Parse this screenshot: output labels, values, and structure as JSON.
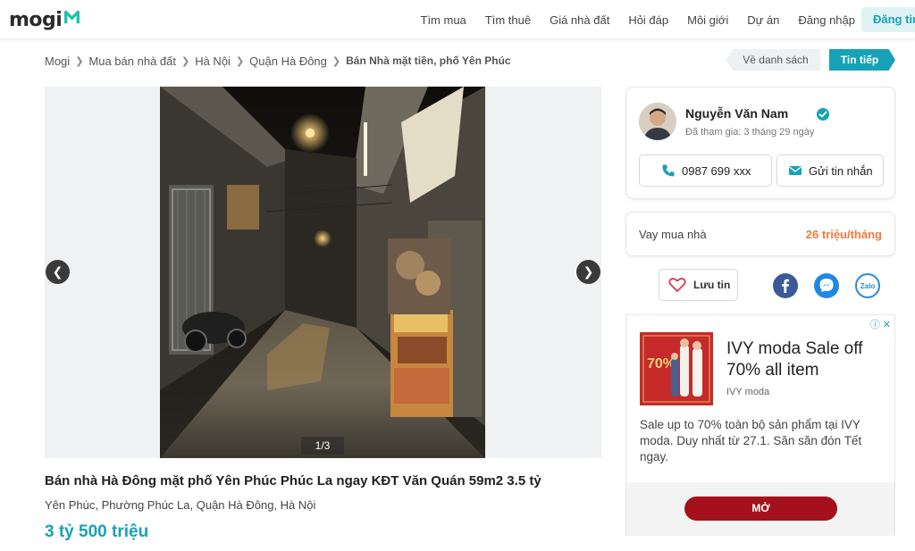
{
  "header": {
    "logo_text": "mogi",
    "nav": [
      "Tìm mua",
      "Tìm thuê",
      "Giá nhà đất",
      "Hỏi đáp",
      "Môi giới",
      "Dự án",
      "Đăng nhập"
    ],
    "register_label": "Đăng tin",
    "brand_color": "#17a2b8"
  },
  "breadcrumb": {
    "items": [
      "Mogi",
      "Mua bán nhà đất",
      "Hà Nội",
      "Quận Hà Đông"
    ],
    "current": "Bán Nhà mặt tiền, phố Yên Phúc"
  },
  "nav_buttons": {
    "back": "Về danh sách",
    "next": "Tin tiếp"
  },
  "gallery": {
    "counter": "1/3"
  },
  "listing": {
    "title": "Bán nhà Hà Đông mặt phố Yên Phúc Phúc La ngay KĐT Văn Quán 59m2 3.5 tỷ",
    "address": "Yên Phúc, Phường Phúc La, Quận Hà Đông, Hà Nội",
    "price": "3 tỷ 500 triệu"
  },
  "agent": {
    "name": "Nguyễn Văn Nam",
    "joined": "Đã tham gia: 3 tháng 29 ngày",
    "phone": "0987 699 xxx",
    "message_label": "Gửi tin nhắn"
  },
  "loan": {
    "label": "Vay mua nhà",
    "value": "26 triệu/tháng",
    "value_color": "#f07a3a"
  },
  "actions": {
    "save_label": "Lưu tin",
    "zalo_label": "Zalo"
  },
  "ad": {
    "title": "IVY moda Sale off 70% all item",
    "brand": "IVY moda",
    "description": "Sale up to 70% toàn bộ sản phẩm tại IVY moda. Duy nhất từ 27.1. Săn săn đón Tết ngay.",
    "cta": "MỞ",
    "image_badge": "70%",
    "cta_color": "#a4111c"
  }
}
